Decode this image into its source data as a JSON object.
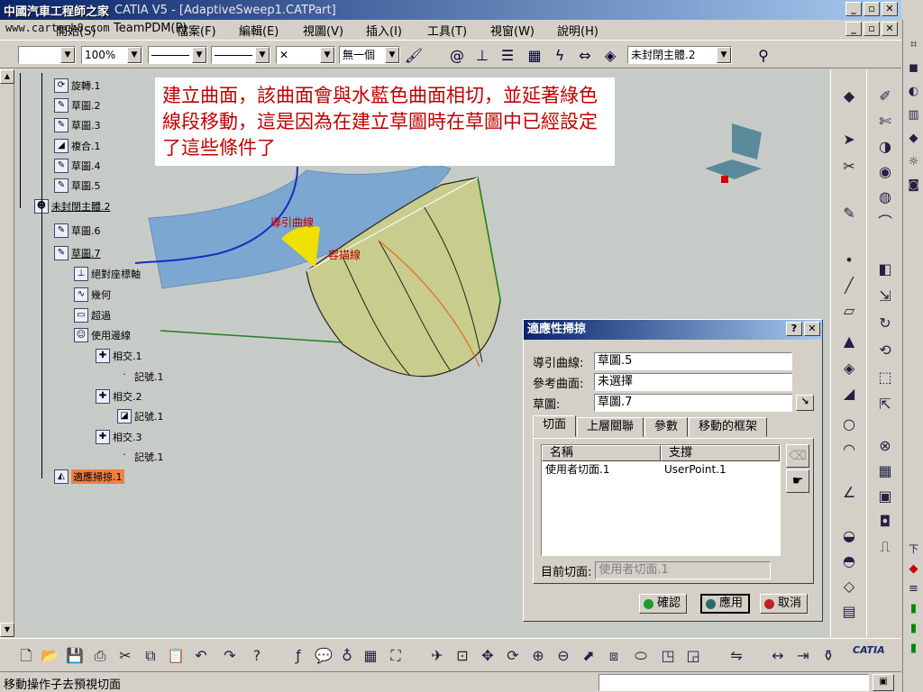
{
  "window": {
    "watermark": "中國汽車工程師之家",
    "title": "CATIA V5 - [AdaptiveSweep1.CATPart]",
    "url": "www.cartech8.com",
    "controls": [
      "_",
      "▫",
      "✕"
    ]
  },
  "menu": {
    "items": [
      "開始(S)",
      "TeamPDM(P)",
      "檔案(F)",
      "編輯(E)",
      "視圖(V)",
      "插入(I)",
      "工具(T)",
      "視窗(W)",
      "說明(H)"
    ]
  },
  "format_toolbar": {
    "zoom": "100%",
    "layer": "無一個",
    "body": "未封閉主體.2",
    "cross": "✕"
  },
  "tree": {
    "nodes": [
      {
        "label": "旋轉.1",
        "icon": "revolve-icon"
      },
      {
        "label": "草圖.2",
        "icon": "sketch-icon"
      },
      {
        "label": "草圖.3",
        "icon": "sketch-icon"
      },
      {
        "label": "複合.1",
        "icon": "combine-icon"
      },
      {
        "label": "草圖.4",
        "icon": "sketch-icon"
      },
      {
        "label": "草圖.5",
        "icon": "sketch-icon"
      },
      {
        "label": "未封閉主體.2",
        "icon": "body-icon"
      },
      {
        "label": "草圖.6",
        "icon": "sketch-icon"
      },
      {
        "label": "草圖.7",
        "icon": "sketch-icon"
      },
      {
        "label": "絕對座標軸",
        "icon": "axis-icon"
      },
      {
        "label": "幾何",
        "icon": "geometry-icon"
      },
      {
        "label": "超過",
        "icon": "beyond-icon"
      },
      {
        "label": "使用邊線",
        "icon": "edge-icon"
      },
      {
        "label": "相交.1",
        "icon": "intersect-icon"
      },
      {
        "label": "記號.1",
        "icon": "mark-icon"
      },
      {
        "label": "相交.2",
        "icon": "intersect-icon"
      },
      {
        "label": "記號.1",
        "icon": "mark-icon"
      },
      {
        "label": "相交.3",
        "icon": "intersect-icon"
      },
      {
        "label": "記號.1",
        "icon": "mark-icon"
      },
      {
        "label": "適應掃掠.1",
        "icon": "sweep-icon"
      }
    ]
  },
  "annotation": {
    "text": "建立曲面，該曲面會與水藍色曲面相切，並延著綠色線段移動，這是因為在建立草圖時在草圖中已經設定了這些條件了"
  },
  "viewport_labels": {
    "guide": "導引曲線",
    "profile": "容描線"
  },
  "dialog": {
    "title": "適應性掃掠",
    "help": "?",
    "close": "✕",
    "fields": [
      {
        "label": "導引曲線:",
        "value": "草圖.5"
      },
      {
        "label": "參考曲面:",
        "value": "未選擇"
      },
      {
        "label": "草圖:",
        "value": "草圖.7"
      }
    ],
    "tabs": [
      "切面",
      "上層關聯",
      "參數",
      "移動的框架"
    ],
    "columns": [
      "名稱",
      "支撐"
    ],
    "rows": [
      [
        "使用者切面.1",
        "UserPoint.1"
      ]
    ],
    "current_label": "目前切面:",
    "current_value": "使用者切面.1",
    "buttons": {
      "ok": "確認",
      "apply": "應用",
      "cancel": "取消"
    }
  },
  "status": {
    "text": "移動操作子去預視切面",
    "logo": "CATIA"
  },
  "colors": {
    "accent_title": "#0a246a",
    "note_text": "#c00000",
    "surface_blue": "#7ba7d0",
    "surface_olive": "#c8cc8c",
    "guide_curve": "#1030c0",
    "green_line": "#208020"
  }
}
